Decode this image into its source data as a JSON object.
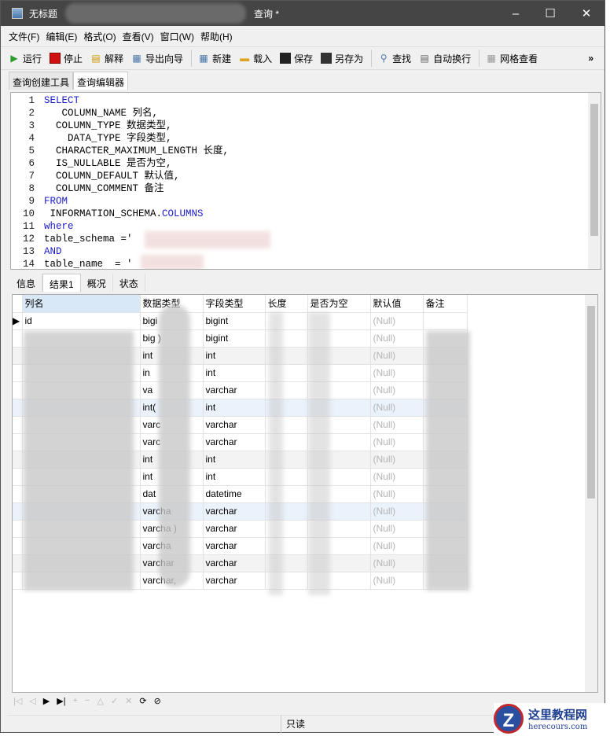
{
  "window": {
    "title_prefix": "无标题",
    "title_suffix": "查询 *",
    "minimize": "–",
    "maximize": "☐",
    "close": "✕"
  },
  "menu": [
    "文件(F)",
    "编辑(E)",
    "格式(O)",
    "查看(V)",
    "窗口(W)",
    "帮助(H)"
  ],
  "toolbar": {
    "run": "运行",
    "stop": "停止",
    "explain": "解释",
    "export": "导出向导",
    "new": "新建",
    "load": "载入",
    "save": "保存",
    "save_as": "另存为",
    "find": "查找",
    "word_wrap": "自动换行",
    "grid_view": "网格查看",
    "more": "»"
  },
  "tabs": [
    "查询创建工具",
    "查询编辑器"
  ],
  "editor": {
    "lines": [
      {
        "n": "1",
        "kw": "SELECT",
        "text": ""
      },
      {
        "n": "2",
        "kw": "",
        "text": "   COLUMN_NAME 列名,"
      },
      {
        "n": "3",
        "kw": "",
        "text": "  COLUMN_TYPE 数据类型,"
      },
      {
        "n": "4",
        "kw": "",
        "text": "    DATA_TYPE 字段类型,"
      },
      {
        "n": "5",
        "kw": "",
        "text": "  CHARACTER_MAXIMUM_LENGTH 长度,"
      },
      {
        "n": "6",
        "kw": "",
        "text": "  IS_NULLABLE 是否为空,"
      },
      {
        "n": "7",
        "kw": "",
        "text": "  COLUMN_DEFAULT 默认值,"
      },
      {
        "n": "8",
        "kw": "",
        "text": "  COLUMN_COMMENT 备注"
      },
      {
        "n": "9",
        "kw": "FROM",
        "text": ""
      },
      {
        "n": "10",
        "kw": "",
        "text": " INFORMATION_SCHEMA.",
        "kw2": "COLUMNS"
      },
      {
        "n": "11",
        "kw": "where",
        "text": ""
      },
      {
        "n": "12",
        "kw": "",
        "text": "table_schema ='"
      },
      {
        "n": "13",
        "kw": "AND",
        "text": ""
      },
      {
        "n": "14",
        "kw": "",
        "text": "table_name  = '"
      }
    ]
  },
  "result_tabs": [
    "信息",
    "结果1",
    "概况",
    "状态"
  ],
  "grid": {
    "columns": [
      "列名",
      "数据类型",
      "字段类型",
      "长度",
      "是否为空",
      "默认值",
      "备注"
    ],
    "rows": [
      [
        "id",
        "bigi",
        "bigint",
        "",
        "",
        "(Null)",
        ""
      ],
      [
        "",
        "big  )",
        "bigint",
        "",
        "",
        "(Null)",
        ""
      ],
      [
        "",
        "int",
        "int",
        "",
        "",
        "(Null)",
        ""
      ],
      [
        "",
        "in",
        "int",
        "",
        "",
        "(Null)",
        ""
      ],
      [
        "",
        "va",
        "varchar",
        "",
        "",
        "(Null)",
        ""
      ],
      [
        "",
        "int(",
        "int",
        "",
        "",
        "(Null)",
        ""
      ],
      [
        "",
        "varc",
        "varchar",
        "",
        "",
        "(Null)",
        ""
      ],
      [
        "",
        "varc",
        "varchar",
        "",
        "",
        "(Null)",
        ""
      ],
      [
        "",
        "int",
        "int",
        "",
        "",
        "(Null)",
        ""
      ],
      [
        "",
        "int",
        "int",
        "",
        "",
        "(Null)",
        ""
      ],
      [
        "",
        "dat",
        "datetime",
        "",
        "",
        "(Null)",
        ""
      ],
      [
        "",
        "varcha",
        "varchar",
        "",
        "",
        "(Null)",
        ""
      ],
      [
        "",
        "varcha  )",
        "varchar",
        "",
        "",
        "(Null)",
        ""
      ],
      [
        "",
        "varcha",
        "varchar",
        "",
        "",
        "(Null)",
        ""
      ],
      [
        "",
        "varchar",
        "varchar",
        "",
        "",
        "(Null)",
        ""
      ],
      [
        "",
        "varchar,",
        "varchar",
        "",
        "",
        "(Null)",
        ""
      ]
    ]
  },
  "nav": [
    "|◁",
    "◁",
    "▶",
    "▶|",
    "+",
    "−",
    "△",
    "✓",
    "✕",
    "⟳",
    "⊘"
  ],
  "status": {
    "readonly": "只读"
  },
  "watermark": {
    "name": "这里教程网",
    "url": "herecours.com"
  }
}
